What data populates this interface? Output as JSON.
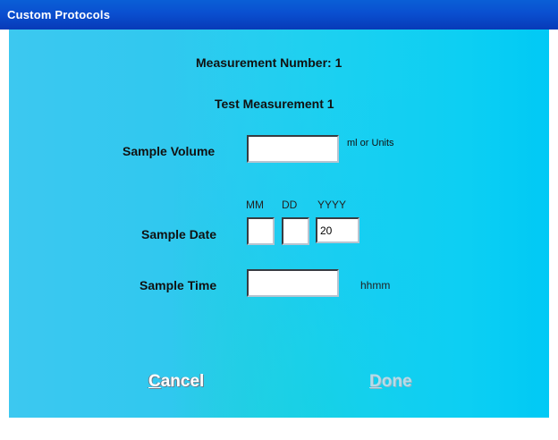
{
  "window": {
    "title": "Custom Protocols",
    "titlebar_color": "#0a4fd0"
  },
  "form": {
    "measurement_number_label": "Measurement Number:",
    "measurement_number_value": "1",
    "measurement_name": "Test Measurement 1",
    "sample_volume": {
      "label": "Sample Volume",
      "value": "",
      "units_hint": "ml or Units"
    },
    "sample_date": {
      "label": "Sample Date",
      "month_header": "MM",
      "day_header": "DD",
      "year_header": "YYYY",
      "month_value": "",
      "day_value": "",
      "year_value": "20"
    },
    "sample_time": {
      "label": "Sample Time",
      "value": "",
      "format_hint": "hhmm"
    }
  },
  "buttons": {
    "cancel": {
      "accel": "C",
      "rest": "ancel",
      "enabled": true
    },
    "done": {
      "accel": "D",
      "rest": "one",
      "enabled": false
    }
  }
}
